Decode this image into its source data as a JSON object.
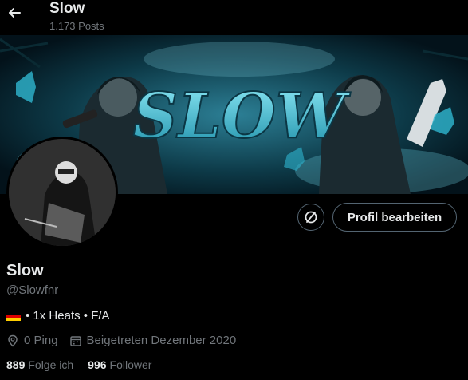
{
  "header": {
    "title": "Slow",
    "post_count": "1.173 Posts"
  },
  "banner": {
    "text": "SLOW"
  },
  "profile": {
    "name": "Slow",
    "handle": "@Slowfnr",
    "bio": "• 1x Heats • F/A",
    "location": "0 Ping",
    "joined": "Beigetreten Dezember 2020",
    "following_count": "889",
    "following_label": "Folge ich",
    "followers_count": "996",
    "followers_label": "Follower"
  },
  "actions": {
    "edit_profile": "Profil bearbeiten"
  },
  "colors": {
    "background": "#000000",
    "text": "#e7e9ea",
    "muted": "#71767b",
    "border": "#536471",
    "banner_accent": "#3fc4dc"
  }
}
